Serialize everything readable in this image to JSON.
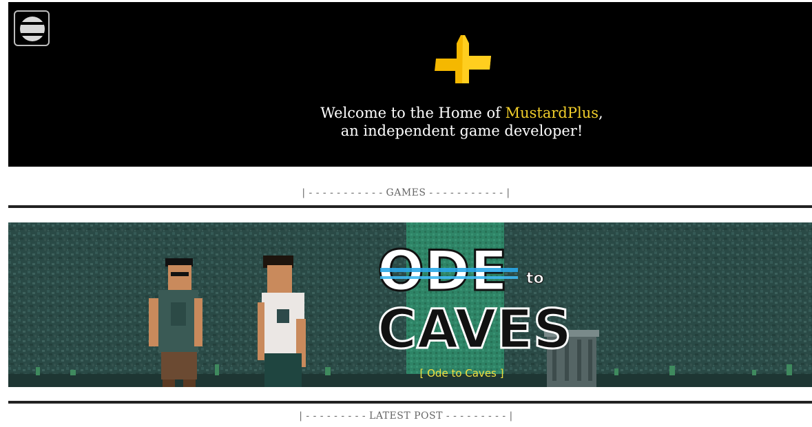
{
  "hero": {
    "welcome_prefix": "Welcome to the Home of ",
    "brand": "MustardPlus",
    "welcome_suffix": ",",
    "line2": "an independent game developer!",
    "brand_color": "#f0cd2a",
    "logo_icon": "mustard-plus-logo-icon",
    "menu_icon": "hamburger-menu-icon"
  },
  "sections": {
    "games_label": "| - - - - - - - - - - - GAMES - - - - - - - - - - - |",
    "latest_post_label": "| - - - - - - - - - LATEST POST - - - - - - - - - |"
  },
  "featured_game": {
    "title_line1": "ODE",
    "title_to": "to",
    "title_line2": "CAVES",
    "link_text": "[ Ode to Caves ]"
  },
  "colors": {
    "hero_bg": "#000000",
    "banner_bg": "#2c4c47",
    "link": "#f0e040"
  }
}
